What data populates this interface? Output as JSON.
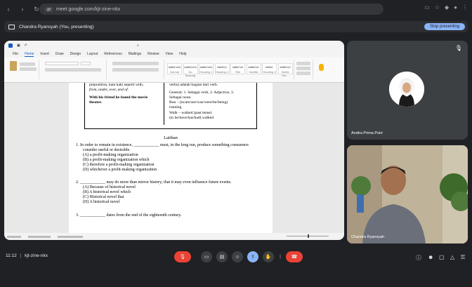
{
  "browser": {
    "url": "meet.google.com/kjt-zine-nkx"
  },
  "presenting": {
    "label": "Chandra Ryansyah (You, presenting)",
    "stop_label": "Stop presenting"
  },
  "word": {
    "menu": [
      "File",
      "Home",
      "Insert",
      "Draw",
      "Design",
      "Layout",
      "References",
      "Mailings",
      "Review",
      "View",
      "Help"
    ],
    "active_menu": "Home",
    "styles": [
      "AaBbCcDd",
      "AaBbCcDd",
      "AaBbCcDd",
      "AaBbCcI",
      "AaBbCcD",
      "AaBbCcD",
      "AaBbC",
      "AaBbCcD"
    ],
    "style_names": [
      "Normal",
      "No Spacing",
      "Heading 1",
      "Heading 2",
      "Title",
      "Subtitle",
      "Heading 4",
      "Subtle Em..."
    ]
  },
  "document": {
    "table_left": [
      "preposition, kata kaki seperti with,",
      "from, under, over, and of.",
      "With his friend he found the movie",
      "theater."
    ],
    "table_right": [
      "verbs) adalah bagian dari verb.",
      "General: 1. Sebagai verb, 2. Adjective, 3.",
      "Sebagai noun.",
      "Run – (to/are/are/was/were/be/being)",
      "running",
      "Walk – walked (past tense)",
      "(to be/have/has/had) walked"
    ],
    "heading": "Latihan",
    "lines": [
      "1.  In order to remain in existence, ____________ must, in the long run, produce something consumers",
      "consider useful or desirable.",
      "(A) a profit-making organization",
      "(B) a profit-making organization which",
      "(C) therefore a profit-making organization",
      "(D) whichever a profit-making organization",
      "2. ____________ may do more than mirror history; that it may even influence future events.",
      "(A) Because of historical novel",
      "(B) A historical novel which",
      "(C) Historical novel that",
      "(D) A historical novel",
      "3. ____________ dates from the end of the eighteenth century."
    ]
  },
  "participants": [
    {
      "name": "Andira Prima Putri"
    },
    {
      "name": "Chandra Ryansyah"
    }
  ],
  "meeting": {
    "time": "11:12",
    "code": "kjt-zine-nkx"
  }
}
